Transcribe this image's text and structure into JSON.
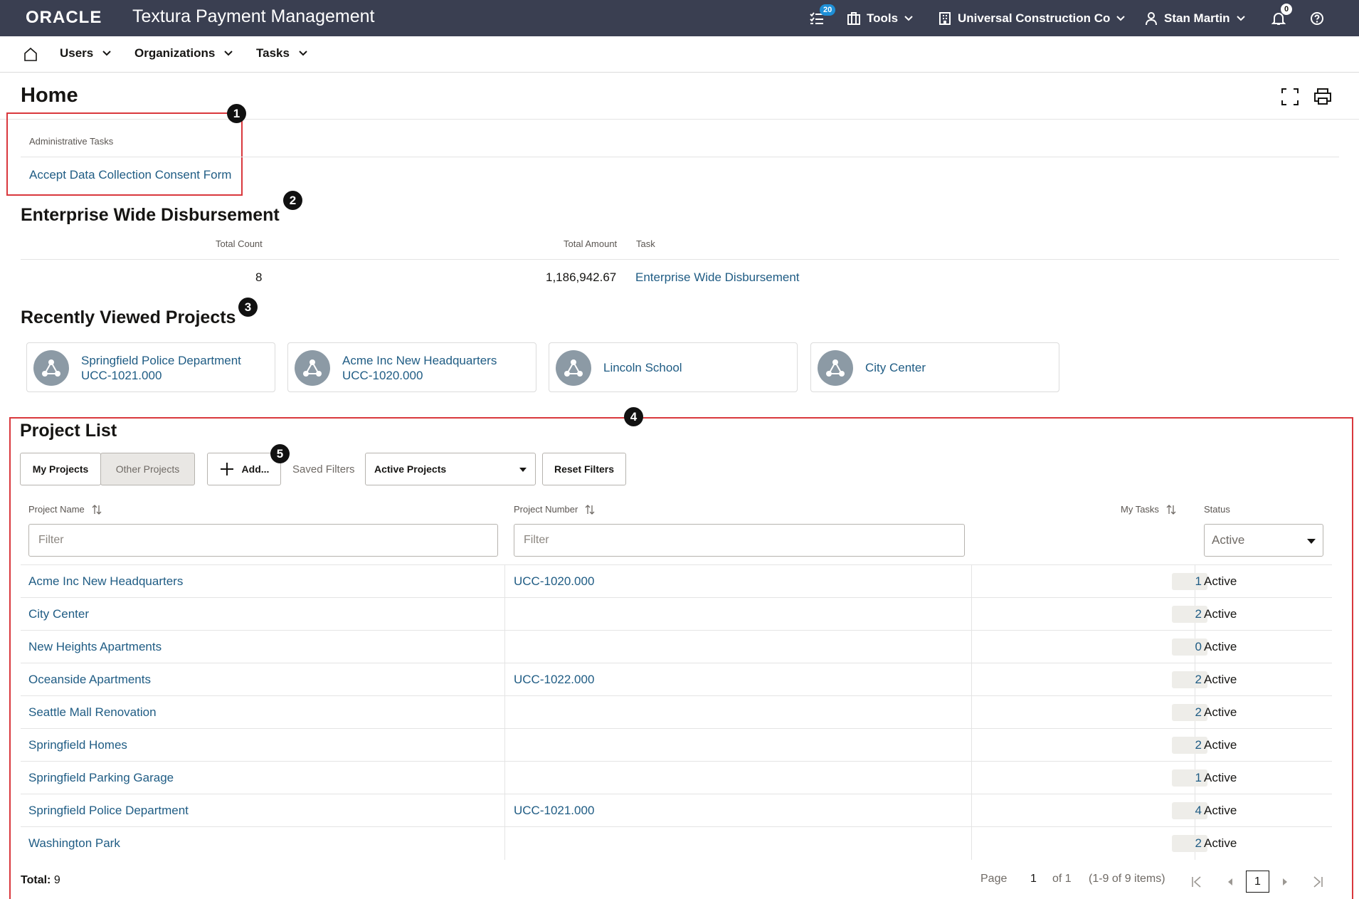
{
  "topbar": {
    "brand": "ORACLE",
    "product_bold": "Textura",
    "product": "Payment Management",
    "tasks_badge": "20",
    "tools_label": "Tools",
    "org_label": "Universal Construction Co",
    "user_label": "Stan Martin",
    "notifications_badge": "0"
  },
  "nav": {
    "items": [
      {
        "label": "Users"
      },
      {
        "label": "Organizations"
      },
      {
        "label": "Tasks"
      }
    ]
  },
  "page": {
    "title": "Home"
  },
  "callouts": [
    "1",
    "2",
    "3",
    "4",
    "5"
  ],
  "admin_tasks": {
    "label": "Administrative Tasks",
    "link": "Accept Data Collection Consent Form"
  },
  "disbursement": {
    "title": "Enterprise Wide Disbursement",
    "headers": {
      "count": "Total Count",
      "amount": "Total Amount",
      "task": "Task"
    },
    "count": "8",
    "amount": "1,186,942.67",
    "task": "Enterprise Wide Disbursement"
  },
  "recent": {
    "title": "Recently Viewed Projects",
    "cards": [
      {
        "name": "Springfield Police Department",
        "number": "UCC-1021.000"
      },
      {
        "name": "Acme Inc New Headquarters",
        "number": "UCC-1020.000"
      },
      {
        "name": "Lincoln School",
        "number": ""
      },
      {
        "name": "City Center",
        "number": ""
      }
    ]
  },
  "project_list": {
    "title": "Project List",
    "tab_my": "My Projects",
    "tab_other": "Other Projects",
    "add_label": "Add...",
    "saved_filters_label": "Saved Filters",
    "saved_filter_value": "Active Projects",
    "reset_label": "Reset Filters",
    "columns": {
      "name": "Project Name",
      "number": "Project Number",
      "tasks": "My Tasks",
      "status": "Status"
    },
    "filter_placeholder": "Filter",
    "status_filter_value": "Active",
    "rows": [
      {
        "name": "Acme Inc New Headquarters",
        "number": "UCC-1020.000",
        "tasks": "1",
        "status": "Active"
      },
      {
        "name": "City Center",
        "number": "",
        "tasks": "2",
        "status": "Active"
      },
      {
        "name": "New Heights Apartments",
        "number": "",
        "tasks": "0",
        "status": "Active"
      },
      {
        "name": "Oceanside Apartments",
        "number": "UCC-1022.000",
        "tasks": "2",
        "status": "Active"
      },
      {
        "name": "Seattle Mall Renovation",
        "number": "",
        "tasks": "2",
        "status": "Active"
      },
      {
        "name": "Springfield Homes",
        "number": "",
        "tasks": "2",
        "status": "Active"
      },
      {
        "name": "Springfield Parking Garage",
        "number": "",
        "tasks": "1",
        "status": "Active"
      },
      {
        "name": "Springfield Police Department",
        "number": "UCC-1021.000",
        "tasks": "4",
        "status": "Active"
      },
      {
        "name": "Washington Park",
        "number": "",
        "tasks": "2",
        "status": "Active"
      }
    ],
    "total_label": "Total:",
    "total_value": "9",
    "page_label": "Page",
    "page_current": "1",
    "page_of": "of 1",
    "page_items": "(1-9 of 9 items)",
    "page_box": "1"
  }
}
